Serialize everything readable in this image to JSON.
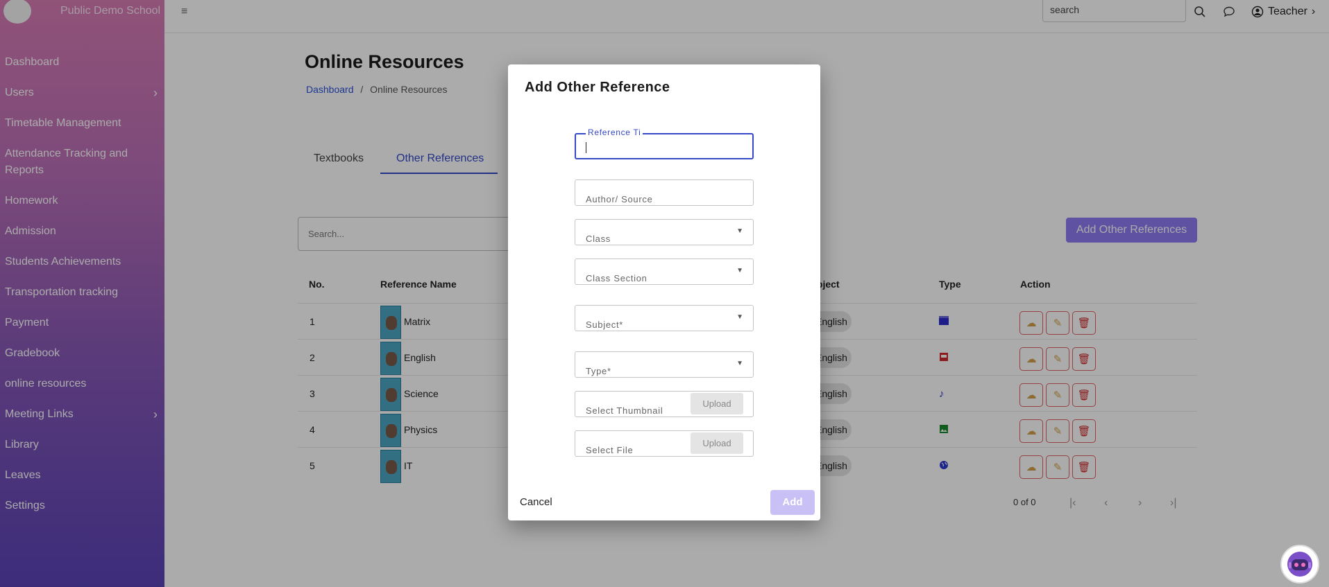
{
  "app": {
    "school_name": "Public Demo School"
  },
  "topbar": {
    "search_placeholder": "search",
    "user_label": "Teacher"
  },
  "sidebar": {
    "items": [
      {
        "label": "Dashboard",
        "has_children": false
      },
      {
        "label": "Users",
        "has_children": true
      },
      {
        "label": "Timetable Management",
        "has_children": false
      },
      {
        "label": "Attendance Tracking and Reports",
        "has_children": false
      },
      {
        "label": "Homework",
        "has_children": false
      },
      {
        "label": "Admission",
        "has_children": false
      },
      {
        "label": "Students Achievements",
        "has_children": false
      },
      {
        "label": "Transportation tracking",
        "has_children": false
      },
      {
        "label": "Payment",
        "has_children": false
      },
      {
        "label": "Gradebook",
        "has_children": false
      },
      {
        "label": "online resources",
        "has_children": false
      },
      {
        "label": "Meeting Links",
        "has_children": true
      },
      {
        "label": "Library",
        "has_children": false
      },
      {
        "label": "Leaves",
        "has_children": false
      },
      {
        "label": "Settings",
        "has_children": false
      }
    ]
  },
  "page": {
    "title": "Online Resources",
    "breadcrumb": {
      "home": "Dashboard",
      "separator": "/",
      "current": "Online Resources"
    },
    "tabs": [
      {
        "label": "Textbooks",
        "active": false
      },
      {
        "label": "Other References",
        "active": true
      }
    ],
    "search_placeholder": "Search...",
    "add_button": "Add Other References"
  },
  "table": {
    "columns": [
      "No.",
      "Reference Name",
      "Subject",
      "Type",
      "Action"
    ],
    "rows": [
      {
        "no": "1",
        "name": "Matrix",
        "subject": "English",
        "type_icon": "video-icon",
        "type_color": "#2a2ad0"
      },
      {
        "no": "2",
        "name": "English",
        "subject": "English",
        "type_icon": "pdf-icon",
        "type_color": "#d02a2a"
      },
      {
        "no": "3",
        "name": "Science",
        "subject": "English",
        "type_icon": "music-note-icon",
        "type_color": "#2a2ad0"
      },
      {
        "no": "4",
        "name": "Physics",
        "subject": "English",
        "type_icon": "image-icon",
        "type_color": "#1a8a2a"
      },
      {
        "no": "5",
        "name": "IT",
        "subject": "English",
        "type_icon": "globe-icon",
        "type_color": "#2a3ad0"
      }
    ],
    "pagination": {
      "range": "0 of 0"
    }
  },
  "modal": {
    "title": "Add Other Reference",
    "fields": {
      "reference_title": "Reference Ti",
      "author": "Author/ Source",
      "class": "Class",
      "class_section": "Class Section",
      "subject": "Subject*",
      "type": "Type*",
      "thumbnail": "Select Thumbnail",
      "file": "Select File"
    },
    "upload_label": "Upload",
    "cancel": "Cancel",
    "add": "Add"
  },
  "colors": {
    "accent": "#3448c8",
    "add_button": "#8f7bf2",
    "action_border": "#e06060"
  }
}
